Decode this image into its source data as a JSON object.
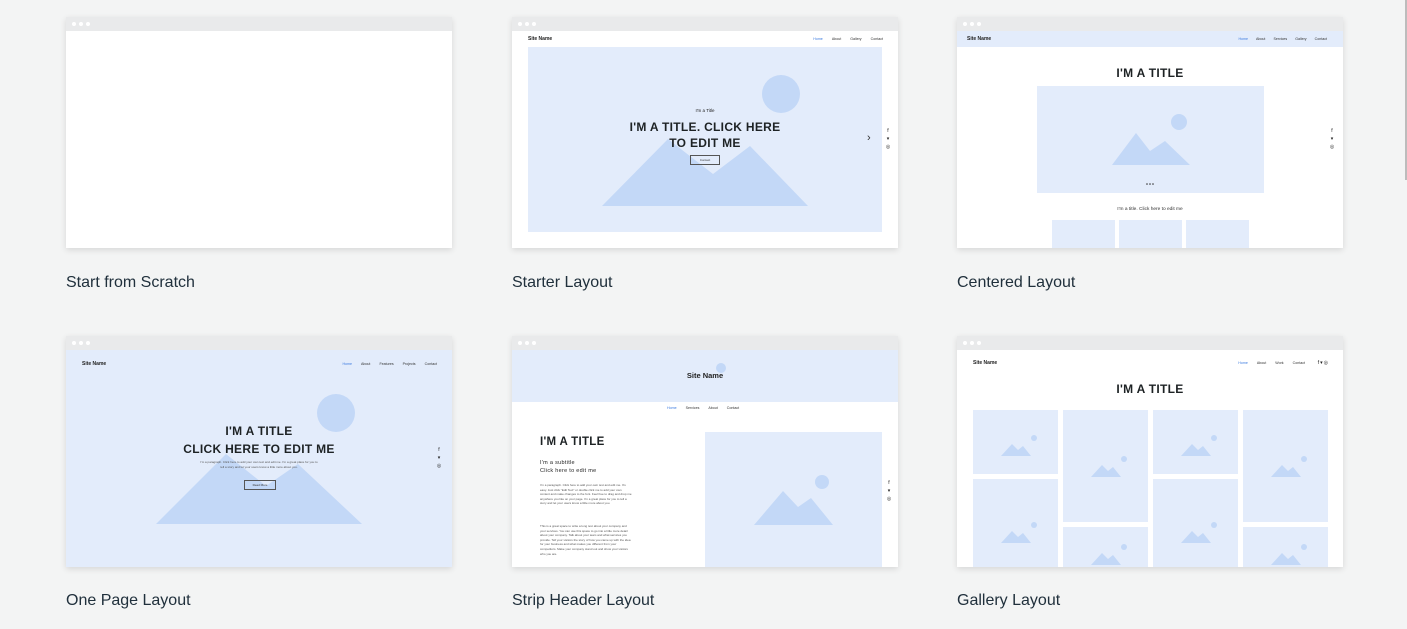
{
  "templates": [
    {
      "name": "Start from Scratch"
    },
    {
      "name": "Starter Layout",
      "preview": {
        "site_name": "Site Name",
        "nav": [
          "Home",
          "About",
          "Gallery",
          "Contact"
        ],
        "kicker": "I'm a Title",
        "title_line1": "I'M A TITLE. CLICK HERE",
        "title_line2": "TO EDIT ME",
        "button": "Contact"
      }
    },
    {
      "name": "Centered Layout",
      "preview": {
        "site_name": "Site Name",
        "nav": [
          "Home",
          "About",
          "Services",
          "Gallery",
          "Contact"
        ],
        "title": "I'M A TITLE",
        "caption": "I'm a title. Click here to edit me"
      }
    },
    {
      "name": "One Page Layout",
      "preview": {
        "site_name": "Site Name",
        "nav": [
          "Home",
          "About",
          "Features",
          "Projects",
          "Contact"
        ],
        "title_line1": "I'M A TITLE",
        "title_line2": "CLICK HERE TO EDIT ME",
        "paragraph": "I'm a paragraph. Click here to add your own text and edit me. I'm a great place for you to tell a story and let your users know a little more about you.",
        "button": "Read More"
      }
    },
    {
      "name": "Strip Header Layout",
      "preview": {
        "site_name": "Site Name",
        "nav": [
          "Home",
          "Services",
          "About",
          "Contact"
        ],
        "title": "I'M A TITLE",
        "subtitle1": "I'm a subtitle",
        "subtitle2": "Click here to edit me",
        "paragraph1": "I'm a paragraph. Click here to add your own text and edit me. It's easy. Just click \"Edit Text\" or double click me to add your own content and make changes to the font. Feel free to drag and drop me anywhere you like on your page. I'm a great place for you to tell a story and let your users know a little more about you.",
        "paragraph2": "This is a great space to write a long text about your company and your services. You can use this space to go into a little more detail about your company. Talk about your team and what services you provide. Tell your visitors the story of how you came up with the idea for your business and what makes you different from your competitors. Make your company stand out and show your visitors who you are."
      }
    },
    {
      "name": "Gallery Layout",
      "preview": {
        "site_name": "Site Name",
        "nav": [
          "Home",
          "About",
          "Work",
          "Contact"
        ],
        "title": "I'M A TITLE"
      }
    }
  ],
  "icons": {
    "social": [
      "facebook-icon",
      "twitter-icon",
      "instagram-icon"
    ],
    "next": "chevron-right-icon"
  },
  "colors": {
    "background": "#f3f4f4",
    "placeholder": "#e3ecfb",
    "shape": "#c3d8f7",
    "accent": "#3c7be0"
  }
}
